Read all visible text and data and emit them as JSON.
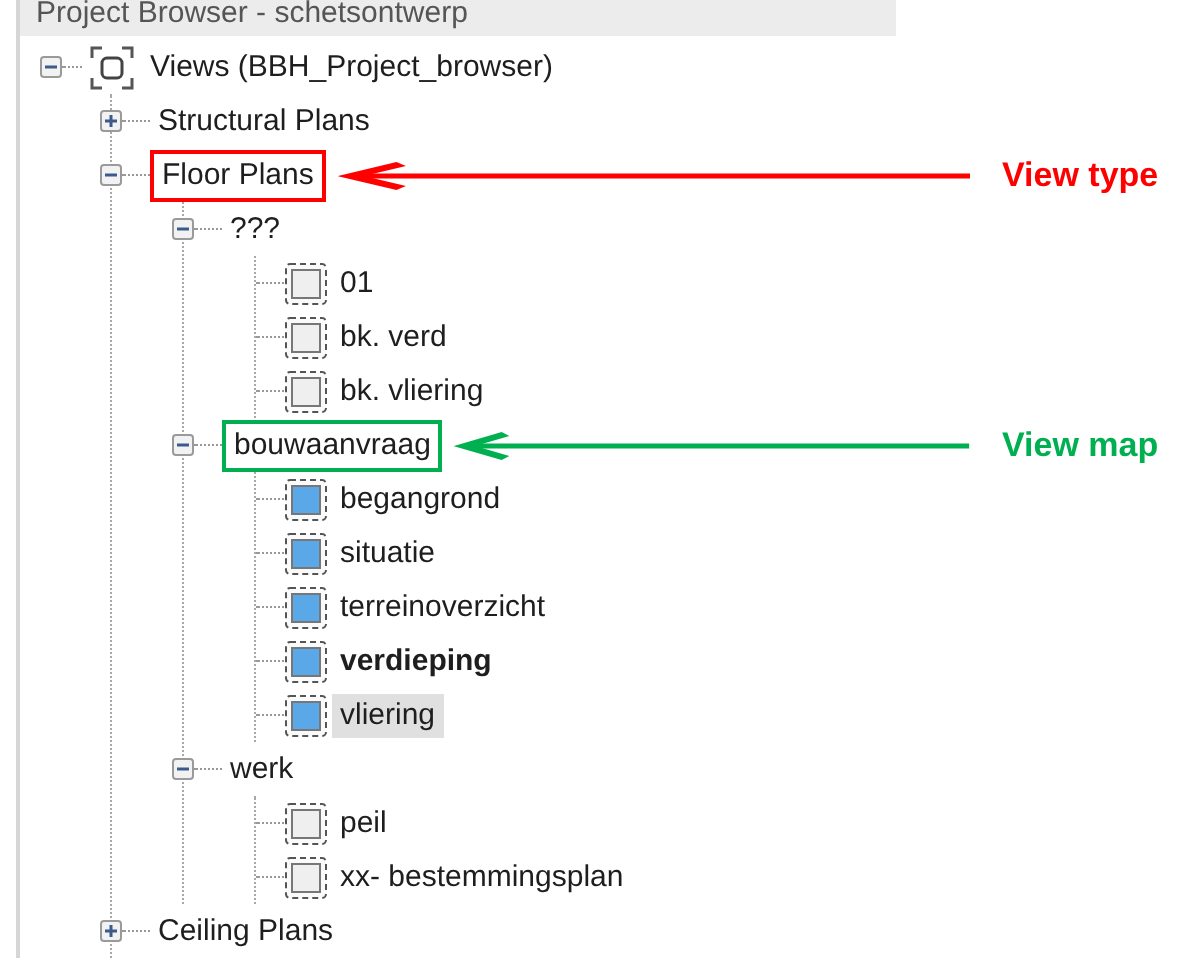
{
  "panel": {
    "title": "Project Browser - schetsontwerp"
  },
  "tree": [
    {
      "kind": "root",
      "label": "Views (BBH_Project_browser)",
      "expanded": true,
      "selected": false,
      "children": [
        {
          "kind": "group",
          "label": "Structural Plans",
          "expanded": false,
          "selected": false
        },
        {
          "kind": "group",
          "label": "Floor Plans",
          "expanded": true,
          "selected": false,
          "callout": {
            "text": "View type",
            "color": "#ff0000"
          },
          "children": [
            {
              "kind": "group",
              "label": "???",
              "expanded": true,
              "selected": false,
              "children": [
                {
                  "kind": "view",
                  "label": "01",
                  "placed": false,
                  "active": false,
                  "selected": false
                },
                {
                  "kind": "view",
                  "label": "bk. verd",
                  "placed": false,
                  "active": false,
                  "selected": false
                },
                {
                  "kind": "view",
                  "label": "bk. vliering",
                  "placed": false,
                  "active": false,
                  "selected": false
                }
              ]
            },
            {
              "kind": "group",
              "label": "bouwaanvraag",
              "expanded": true,
              "selected": false,
              "callout": {
                "text": "View map",
                "color": "#00b050"
              },
              "children": [
                {
                  "kind": "view",
                  "label": "begangrond",
                  "placed": true,
                  "active": false,
                  "selected": false
                },
                {
                  "kind": "view",
                  "label": "situatie",
                  "placed": true,
                  "active": false,
                  "selected": false
                },
                {
                  "kind": "view",
                  "label": "terreinoverzicht",
                  "placed": true,
                  "active": false,
                  "selected": false
                },
                {
                  "kind": "view",
                  "label": "verdieping",
                  "placed": true,
                  "active": true,
                  "selected": false
                },
                {
                  "kind": "view",
                  "label": "vliering",
                  "placed": true,
                  "active": false,
                  "selected": true
                }
              ]
            },
            {
              "kind": "group",
              "label": "werk",
              "expanded": true,
              "selected": false,
              "children": [
                {
                  "kind": "view",
                  "label": "peil",
                  "placed": false,
                  "active": false,
                  "selected": false
                },
                {
                  "kind": "view",
                  "label": "xx- bestemmingsplan",
                  "placed": false,
                  "active": false,
                  "selected": false
                }
              ]
            }
          ]
        },
        {
          "kind": "group",
          "label": "Ceiling Plans",
          "expanded": false,
          "selected": false
        }
      ]
    }
  ]
}
